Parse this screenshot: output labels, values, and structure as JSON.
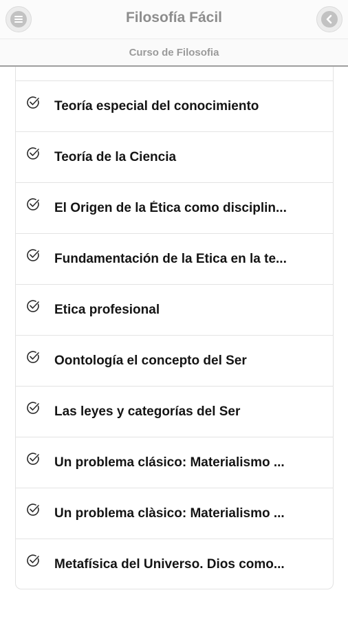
{
  "header": {
    "title": "Filosofía Fácil",
    "menu_icon": "hamburger-menu-icon",
    "back_icon": "back-arrow-icon"
  },
  "subheader": {
    "title": "Curso de Filosofia"
  },
  "list": {
    "check_icon": "checkmark-circle-icon",
    "items": [
      {
        "label": "Teoría especial del conocimiento"
      },
      {
        "label": "Teoría de la Ciencia"
      },
      {
        "label": "El Origen de la Ética como disciplin..."
      },
      {
        "label": "Fundamentación de la Etica en la te..."
      },
      {
        "label": "Etica profesional"
      },
      {
        "label": "Oontología el concepto del Ser"
      },
      {
        "label": "Las leyes y categorías del Ser"
      },
      {
        "label": "Un problema clásico: Materialismo ..."
      },
      {
        "label": "Un problema clàsico: Materialismo ..."
      },
      {
        "label": "Metafísica del Universo. Dios como..."
      }
    ]
  },
  "colors": {
    "header_bg": "#fbfbfb",
    "title_text": "#8d8d8d",
    "item_text": "#141414",
    "divider": "#e3e3e3"
  }
}
